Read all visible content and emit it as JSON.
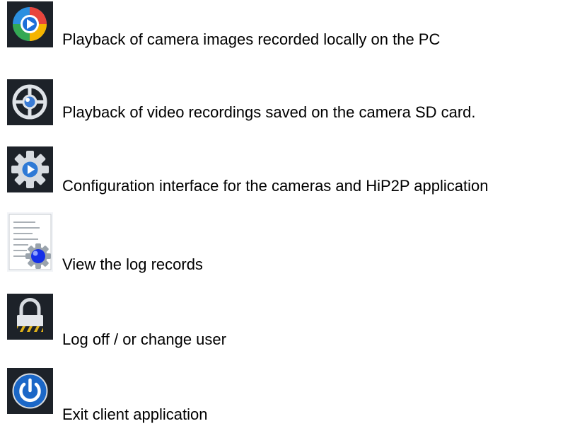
{
  "items": [
    {
      "icon": "pc-playback-icon",
      "label": "Playback of camera images recorded locally on the PC"
    },
    {
      "icon": "sd-card-playback-icon",
      "label": "Playback of video recordings saved on the camera SD card."
    },
    {
      "icon": "settings-gear-icon",
      "label": "Configuration interface for the cameras and HiP2P application"
    },
    {
      "icon": "log-records-icon",
      "label": "View the log records"
    },
    {
      "icon": "lock-icon",
      "label": "Log off / or change user"
    },
    {
      "icon": "power-icon",
      "label": "Exit client application"
    }
  ]
}
